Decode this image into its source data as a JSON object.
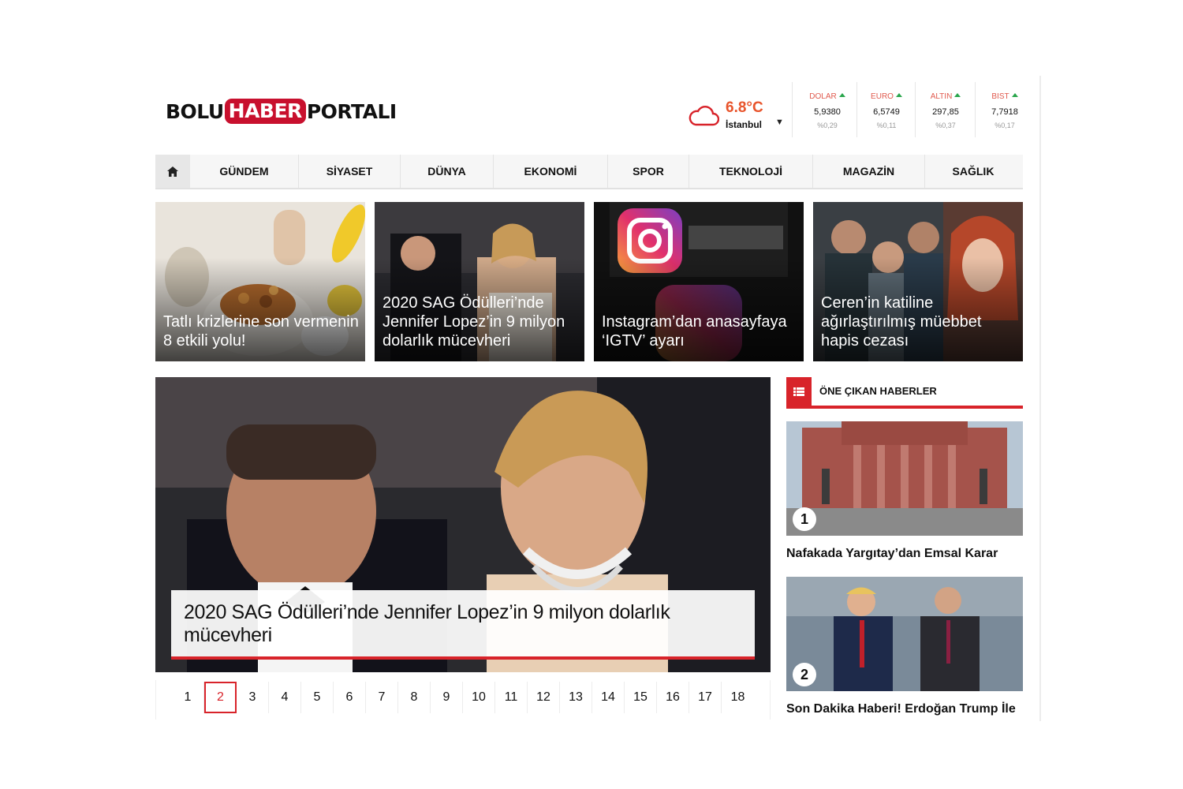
{
  "logo": {
    "part1": "BOLU",
    "part2": "HABER",
    "part3": "PORTALI"
  },
  "weather": {
    "temp": "6.8°C",
    "city": "İstanbul",
    "icon": "cloud-icon",
    "color": "#e8542b"
  },
  "markets": [
    {
      "label": "DOLAR",
      "value": "5,9380",
      "change": "%0,29",
      "trend": "up"
    },
    {
      "label": "EURO",
      "value": "6,5749",
      "change": "%0,11",
      "trend": "up"
    },
    {
      "label": "ALTIN",
      "value": "297,85",
      "change": "%0,37",
      "trend": "up"
    },
    {
      "label": "BIST",
      "value": "7,7918",
      "change": "%0,17",
      "trend": "up"
    }
  ],
  "nav": {
    "home_icon": "home-icon",
    "items": [
      "GÜNDEM",
      "SİYASET",
      "DÜNYA",
      "EKONOMİ",
      "SPOR",
      "TEKNOLOJİ",
      "MAGAZİN",
      "SAĞLIK"
    ]
  },
  "top_cards": [
    {
      "title": "Tatlı krizlerine son vermenin 8 etkili yolu!"
    },
    {
      "title": "2020 SAG Ödülleri’nde Jennifer Lopez’in 9 milyon dolarlık mücevheri"
    },
    {
      "title": "Instagram’dan anasayfaya ‘IGTV’ ayarı"
    },
    {
      "title": "Ceren’in katiline ağırlaştırılmış müebbet hapis cezası"
    }
  ],
  "slider": {
    "caption": "2020 SAG Ödülleri’nde Jennifer Lopez’in 9 milyon dolarlık mücevheri",
    "pages": [
      "1",
      "2",
      "3",
      "4",
      "5",
      "6",
      "7",
      "8",
      "9",
      "10",
      "11",
      "12",
      "13",
      "14",
      "15",
      "16",
      "17",
      "18"
    ],
    "active_page": "2"
  },
  "sidebar": {
    "title": "ÖNE ÇIKAN HABERLER",
    "icon": "list-icon",
    "items": [
      {
        "num": "1",
        "title": "Nafakada Yargıtay’dan Emsal Karar"
      },
      {
        "num": "2",
        "title": "Son Dakika Haberi! Erdoğan Trump İle"
      }
    ]
  },
  "colors": {
    "accent": "#d8232a",
    "brand": "#c8102e",
    "up": "#2aa64c"
  }
}
